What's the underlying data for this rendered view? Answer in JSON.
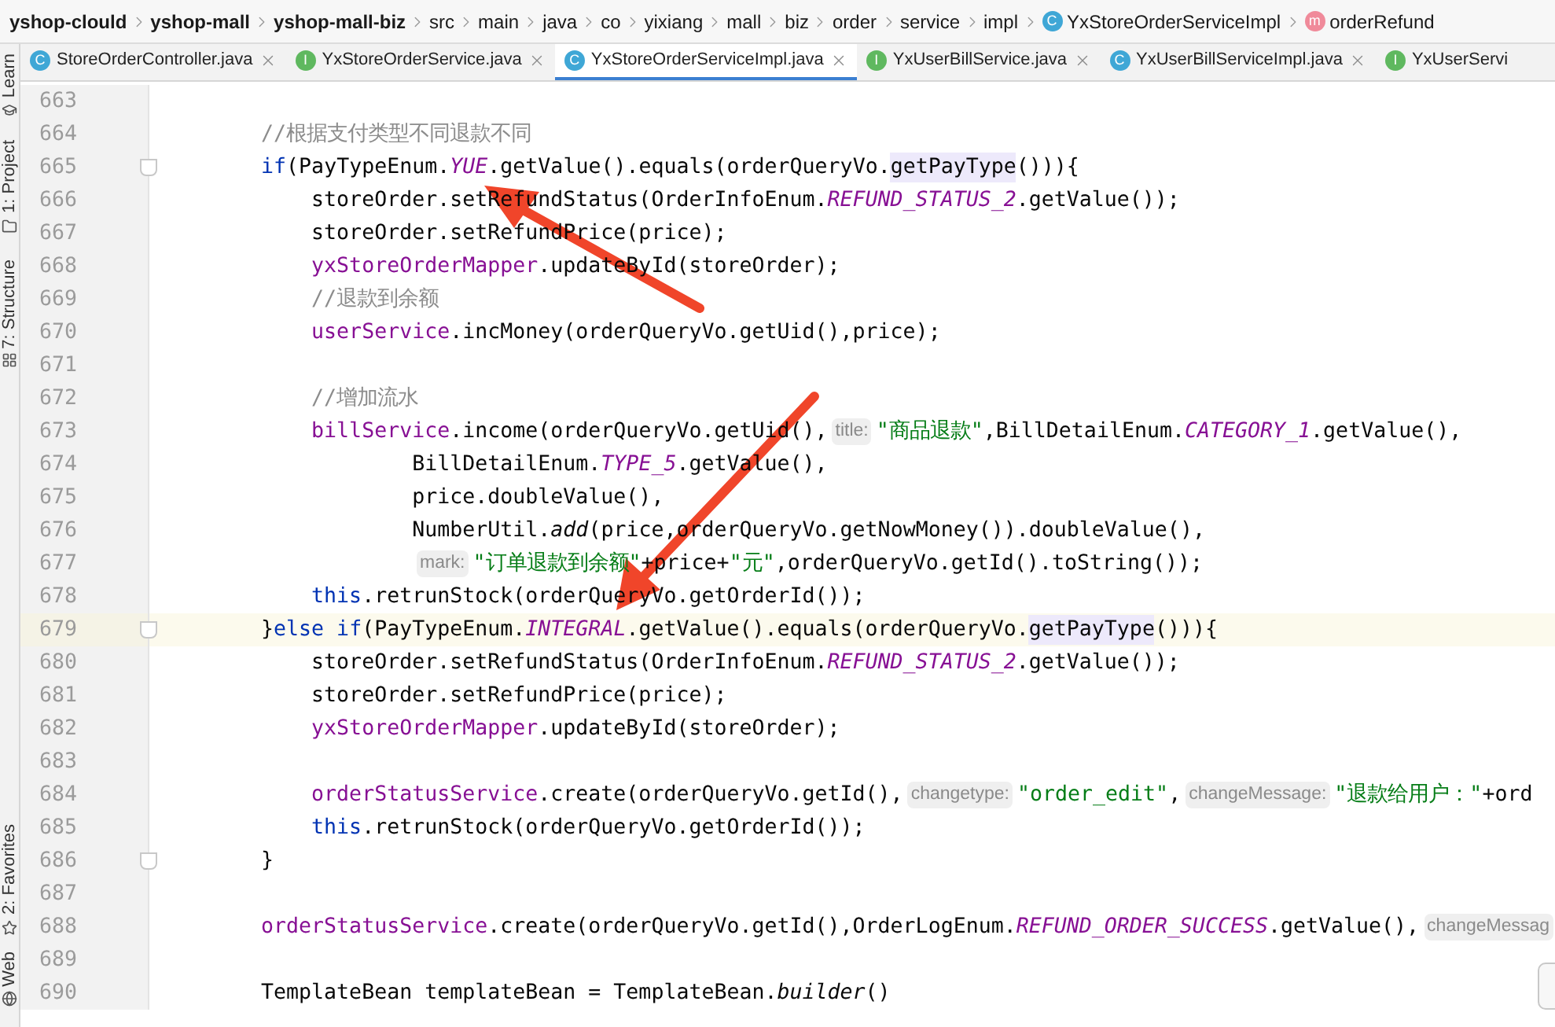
{
  "breadcrumbs": [
    {
      "label": "yshop-clould",
      "bold": true
    },
    {
      "label": "yshop-mall",
      "bold": true
    },
    {
      "label": "yshop-mall-biz",
      "bold": true
    },
    {
      "label": "src",
      "bold": false
    },
    {
      "label": "main",
      "bold": false
    },
    {
      "label": "java",
      "bold": false
    },
    {
      "label": "co",
      "bold": false
    },
    {
      "label": "yixiang",
      "bold": false
    },
    {
      "label": "mall",
      "bold": false
    },
    {
      "label": "biz",
      "bold": false
    },
    {
      "label": "order",
      "bold": false
    },
    {
      "label": "service",
      "bold": false
    },
    {
      "label": "impl",
      "bold": false
    },
    {
      "label": "YxStoreOrderServiceImpl",
      "bold": false,
      "icon": "C",
      "kind": "class"
    },
    {
      "label": "orderRefund",
      "bold": false,
      "icon": "m",
      "kind": "method"
    }
  ],
  "tabs": [
    {
      "label": "StoreOrderController.java",
      "icon": "C",
      "kind": "class",
      "selected": false,
      "closable": true
    },
    {
      "label": "YxStoreOrderService.java",
      "icon": "I",
      "kind": "interface",
      "selected": false,
      "closable": true
    },
    {
      "label": "YxStoreOrderServiceImpl.java",
      "icon": "C",
      "kind": "class",
      "selected": true,
      "closable": true
    },
    {
      "label": "YxUserBillService.java",
      "icon": "I",
      "kind": "interface",
      "selected": false,
      "closable": true
    },
    {
      "label": "YxUserBillServiceImpl.java",
      "icon": "C",
      "kind": "class",
      "selected": false,
      "closable": true
    },
    {
      "label": "YxUserServi",
      "icon": "I",
      "kind": "interface",
      "selected": false,
      "closable": false
    }
  ],
  "tool_strip": [
    {
      "label": "Learn",
      "kind": "learn"
    },
    {
      "label": "1: Project",
      "kind": "project"
    },
    {
      "label": "7: Structure",
      "kind": "structure"
    },
    {
      "label": "2: Favorites",
      "kind": "favorites"
    },
    {
      "label": "Web",
      "kind": "web"
    }
  ],
  "editor": {
    "lines": [
      {
        "number": "663",
        "fold": false,
        "current": false
      },
      {
        "number": "664",
        "fold": false,
        "current": false,
        "tokens": [
          {
            "kind": "comment",
            "text": "    //根据支付类型不同退款不同"
          }
        ]
      },
      {
        "number": "665",
        "fold": true,
        "current": false,
        "tokens": [
          {
            "kind": "keyword",
            "text": "    if"
          },
          {
            "kind": "plain",
            "text": "(PayTypeEnum."
          },
          {
            "kind": "constant",
            "text": "YUE"
          },
          {
            "kind": "plain",
            "text": ".getValue().equals(orderQueryVo."
          },
          {
            "kind": "usage",
            "text": "getPayType"
          },
          {
            "kind": "plain",
            "text": "())){"
          }
        ]
      },
      {
        "number": "666",
        "fold": false,
        "current": false,
        "tokens": [
          {
            "kind": "plain",
            "text": "        storeOrder.setRefundStatus(OrderInfoEnum."
          },
          {
            "kind": "constant",
            "text": "REFUND_STATUS_2"
          },
          {
            "kind": "plain",
            "text": ".getValue());"
          }
        ]
      },
      {
        "number": "667",
        "fold": false,
        "current": false,
        "tokens": [
          {
            "kind": "plain",
            "text": "        storeOrder.setRefundPrice(price);"
          }
        ]
      },
      {
        "number": "668",
        "fold": false,
        "current": false,
        "tokens": [
          {
            "kind": "field",
            "text": "        yxStoreOrderMapper"
          },
          {
            "kind": "plain",
            "text": ".updateById(storeOrder);"
          }
        ]
      },
      {
        "number": "669",
        "fold": false,
        "current": false,
        "tokens": [
          {
            "kind": "comment",
            "text": "        //退款到余额"
          }
        ]
      },
      {
        "number": "670",
        "fold": false,
        "current": false,
        "tokens": [
          {
            "kind": "field",
            "text": "        userService"
          },
          {
            "kind": "plain",
            "text": ".incMoney(orderQueryVo.getUid(),price);"
          }
        ]
      },
      {
        "number": "671",
        "fold": false,
        "current": false
      },
      {
        "number": "672",
        "fold": false,
        "current": false,
        "tokens": [
          {
            "kind": "comment",
            "text": "        //增加流水"
          }
        ]
      },
      {
        "number": "673",
        "fold": false,
        "current": false,
        "tokens": [
          {
            "kind": "field",
            "text": "        billService"
          },
          {
            "kind": "plain",
            "text": ".income(orderQueryVo.getUid(),"
          },
          {
            "kind": "hint",
            "text": "title:"
          },
          {
            "kind": "string",
            "text": "\"商品退款\""
          },
          {
            "kind": "plain",
            "text": ",BillDetailEnum."
          },
          {
            "kind": "constant",
            "text": "CATEGORY_1"
          },
          {
            "kind": "plain",
            "text": ".getValue(),"
          }
        ]
      },
      {
        "number": "674",
        "fold": false,
        "current": false,
        "tokens": [
          {
            "kind": "plain",
            "text": "                BillDetailEnum."
          },
          {
            "kind": "constant",
            "text": "TYPE_5"
          },
          {
            "kind": "plain",
            "text": ".getValue(),"
          }
        ]
      },
      {
        "number": "675",
        "fold": false,
        "current": false,
        "tokens": [
          {
            "kind": "plain",
            "text": "                price.doubleValue(),"
          }
        ]
      },
      {
        "number": "676",
        "fold": false,
        "current": false,
        "tokens": [
          {
            "kind": "plain",
            "text": "                NumberUtil."
          },
          {
            "kind": "static",
            "text": "add"
          },
          {
            "kind": "plain",
            "text": "(price,orderQueryVo.getNowMoney()).doubleValue(),"
          }
        ]
      },
      {
        "number": "677",
        "fold": false,
        "current": false,
        "tokens": [
          {
            "kind": "continuation_hint",
            "text": "mark:"
          },
          {
            "kind": "string",
            "text": "\"订单退款到余额\""
          },
          {
            "kind": "plain",
            "text": "+price+"
          },
          {
            "kind": "string",
            "text": "\"元\""
          },
          {
            "kind": "plain",
            "text": ",orderQueryVo.getId().toString());"
          }
        ]
      },
      {
        "number": "678",
        "fold": false,
        "current": false,
        "tokens": [
          {
            "kind": "keyword",
            "text": "        this"
          },
          {
            "kind": "plain",
            "text": ".retrunStock(orderQueryVo.getOrderId());"
          }
        ]
      },
      {
        "number": "679",
        "fold": true,
        "current": true,
        "tokens": [
          {
            "kind": "plain",
            "text": "    }"
          },
          {
            "kind": "keyword",
            "text": "else if"
          },
          {
            "kind": "plain",
            "text": "(PayTypeEnum."
          },
          {
            "kind": "constant",
            "text": "INTEGRAL"
          },
          {
            "kind": "plain",
            "text": ".getValue().equals(orderQueryVo."
          },
          {
            "kind": "usage",
            "text": "getPayType"
          },
          {
            "kind": "plain",
            "text": "())){"
          }
        ]
      },
      {
        "number": "680",
        "fold": false,
        "current": false,
        "tokens": [
          {
            "kind": "plain",
            "text": "        storeOrder.setRefundStatus(OrderInfoEnum."
          },
          {
            "kind": "constant",
            "text": "REFUND_STATUS_2"
          },
          {
            "kind": "plain",
            "text": ".getValue());"
          }
        ]
      },
      {
        "number": "681",
        "fold": false,
        "current": false,
        "tokens": [
          {
            "kind": "plain",
            "text": "        storeOrder.setRefundPrice(price);"
          }
        ]
      },
      {
        "number": "682",
        "fold": false,
        "current": false,
        "tokens": [
          {
            "kind": "field",
            "text": "        yxStoreOrderMapper"
          },
          {
            "kind": "plain",
            "text": ".updateById(storeOrder);"
          }
        ]
      },
      {
        "number": "683",
        "fold": false,
        "current": false
      },
      {
        "number": "684",
        "fold": false,
        "current": false,
        "tokens": [
          {
            "kind": "field",
            "text": "        orderStatusService"
          },
          {
            "kind": "plain",
            "text": ".create(orderQueryVo.getId(),"
          },
          {
            "kind": "hint",
            "text": "changetype:"
          },
          {
            "kind": "string",
            "text": "\"order_edit\""
          },
          {
            "kind": "plain",
            "text": ","
          },
          {
            "kind": "hint",
            "text": "changeMessage:"
          },
          {
            "kind": "string",
            "text": "\"退款给用户：\""
          },
          {
            "kind": "plain",
            "text": "+ord"
          }
        ]
      },
      {
        "number": "685",
        "fold": false,
        "current": false,
        "tokens": [
          {
            "kind": "keyword",
            "text": "        this"
          },
          {
            "kind": "plain",
            "text": ".retrunStock(orderQueryVo.getOrderId());"
          }
        ]
      },
      {
        "number": "686",
        "fold": true,
        "current": false,
        "tokens": [
          {
            "kind": "plain",
            "text": "    }"
          }
        ]
      },
      {
        "number": "687",
        "fold": false,
        "current": false
      },
      {
        "number": "688",
        "fold": false,
        "current": false,
        "tokens": [
          {
            "kind": "field",
            "text": "    orderStatusService"
          },
          {
            "kind": "plain",
            "text": ".create(orderQueryVo.getId(),OrderLogEnum."
          },
          {
            "kind": "constant",
            "text": "REFUND_ORDER_SUCCESS"
          },
          {
            "kind": "plain",
            "text": ".getValue(),"
          },
          {
            "kind": "hint",
            "text": "changeMessag"
          }
        ]
      },
      {
        "number": "689",
        "fold": false,
        "current": false
      },
      {
        "number": "690",
        "fold": false,
        "current": false,
        "tokens": [
          {
            "kind": "plain",
            "text": "    TemplateBean templateBean = TemplateBean."
          },
          {
            "kind": "static",
            "text": "builder"
          },
          {
            "kind": "plain",
            "text": "()"
          }
        ]
      }
    ]
  }
}
